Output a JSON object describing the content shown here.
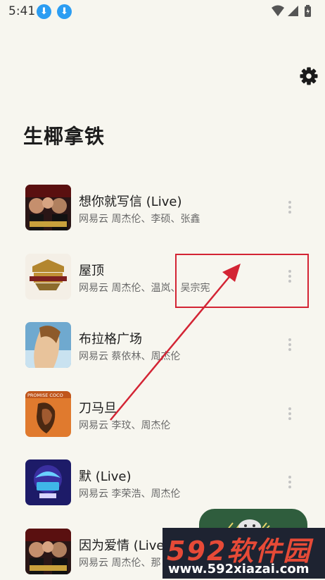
{
  "status_bar": {
    "time": "5:41",
    "notification_icons": [
      "download-icon",
      "download-icon"
    ],
    "right_icons": [
      "wifi-icon",
      "signal-icon",
      "battery-charging-icon"
    ]
  },
  "header": {
    "settings_icon": "gear-icon",
    "title": "生椰拿铁"
  },
  "songs": [
    {
      "title": "想你就写信 (Live)",
      "subtitle": "网易云   周杰伦、李硕、张鑫",
      "cover": "singer-china-cover"
    },
    {
      "title": "屋顶",
      "subtitle": "网易云   周杰伦、温岚、吴宗宪",
      "cover": "gold-logo-cover"
    },
    {
      "title": "布拉格广场",
      "subtitle": "网易云   蔡依林、周杰伦",
      "cover": "portrait-blue-cover"
    },
    {
      "title": "刀马旦",
      "subtitle": "网易云   李玟、周杰伦",
      "cover": "promise-coco-cover"
    },
    {
      "title": "默 (Live)",
      "subtitle": "网易云   李荣浩、周杰伦",
      "cover": "china-voice-cover"
    },
    {
      "title": "因为爱情 (Live)",
      "subtitle": "网易云   周杰伦、那",
      "cover": "singer-china-cover"
    }
  ],
  "annotation": {
    "color": "#d32434"
  },
  "watermark": {
    "brand": "592软件园",
    "url": "www.592xiazai.com"
  },
  "colors": {
    "background": "#f7f6ef",
    "accent": "#2c9df2",
    "player": "#2f5d3d"
  }
}
